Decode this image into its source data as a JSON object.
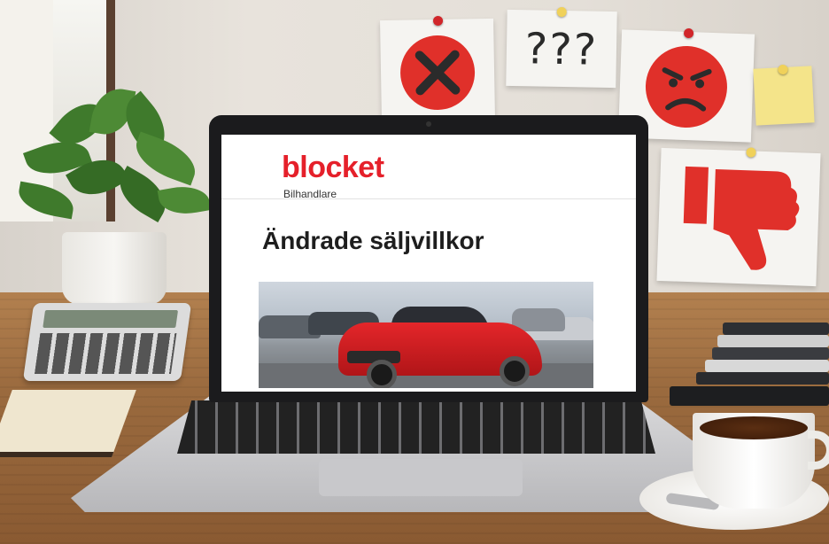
{
  "screen": {
    "brand": "blocket",
    "brand_subtitle": "Bilhandlare",
    "headline": "Ändrade säljvillkor"
  },
  "wall_notes": [
    {
      "type": "icon",
      "icon": "x-icon",
      "color": "#e0302a"
    },
    {
      "type": "text",
      "text": "???"
    },
    {
      "type": "icon",
      "icon": "angry-face-icon",
      "color": "#e0302a"
    },
    {
      "type": "icon",
      "icon": "thumbs-down-icon",
      "color": "#e0302a"
    },
    {
      "type": "sticky",
      "color": "#f4e48a"
    }
  ],
  "colors": {
    "brand_red": "#e5202a",
    "car_red": "#d21e22",
    "desk": "#a8754a"
  }
}
